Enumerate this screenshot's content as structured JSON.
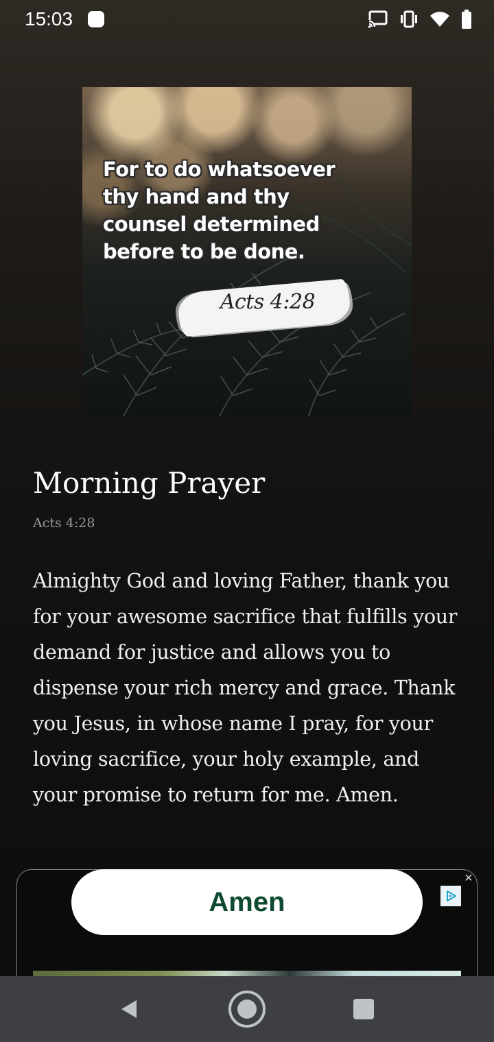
{
  "status_bar": {
    "time": "15:03",
    "icons": [
      "notification-dot-icon",
      "cast-icon",
      "vibrate-icon",
      "wifi-icon",
      "battery-icon"
    ]
  },
  "verse_image": {
    "quote_lines": [
      "For to do whatsoever",
      "thy hand and thy",
      "counsel determined",
      "before to be done."
    ],
    "reference": "Acts 4:28"
  },
  "prayer": {
    "title": "Morning Prayer",
    "reference": "Acts 4:28",
    "body": "Almighty God and loving Father, thank you for your awesome sacrifice that fulfills your demand for justice and allows you to dispense your rich mercy and grace. Thank you Jesus, in whose name I pray, for your loving sacrifice, your holy example, and your promise to return for me. Amen."
  },
  "amen_button": {
    "label": "Amen",
    "text_color": "#0e4a2f"
  },
  "ad": {
    "close_label": "✕",
    "adchoices_icon": "adchoices-icon"
  },
  "nav_bar": {
    "buttons": [
      "back-icon",
      "home-icon",
      "recents-icon"
    ]
  }
}
